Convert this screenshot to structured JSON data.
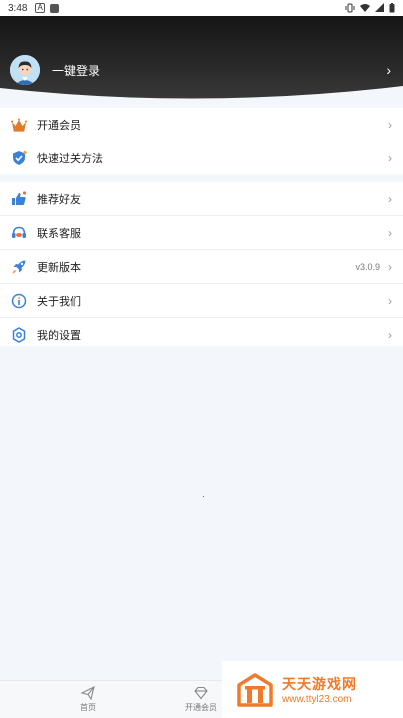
{
  "status_bar": {
    "time": "3:48",
    "notif_a": "A"
  },
  "header": {
    "login_label": "一键登录",
    "chevron": "›"
  },
  "menu_group_1": [
    {
      "label": "开通会员",
      "icon": "crown-icon"
    },
    {
      "label": "快速过关方法",
      "icon": "shield-check-icon"
    }
  ],
  "menu_group_2": [
    {
      "label": "推荐好友",
      "icon": "thumbs-up-icon"
    },
    {
      "label": "联系客服",
      "icon": "headset-icon"
    },
    {
      "label": "更新版本",
      "icon": "rocket-icon",
      "version": "v3.0.9"
    },
    {
      "label": "关于我们",
      "icon": "info-icon"
    },
    {
      "label": "我的设置",
      "icon": "settings-gear-icon"
    }
  ],
  "tabbar": {
    "home_label": "首页",
    "vip_label": "开通会员"
  },
  "watermark": {
    "title": "天天游戏网",
    "url": "www.ttyl23.com"
  },
  "colors": {
    "accent_orange": "#f07a2a",
    "icon_blue": "#3b82d6",
    "crown_orange": "#e07b2b"
  }
}
